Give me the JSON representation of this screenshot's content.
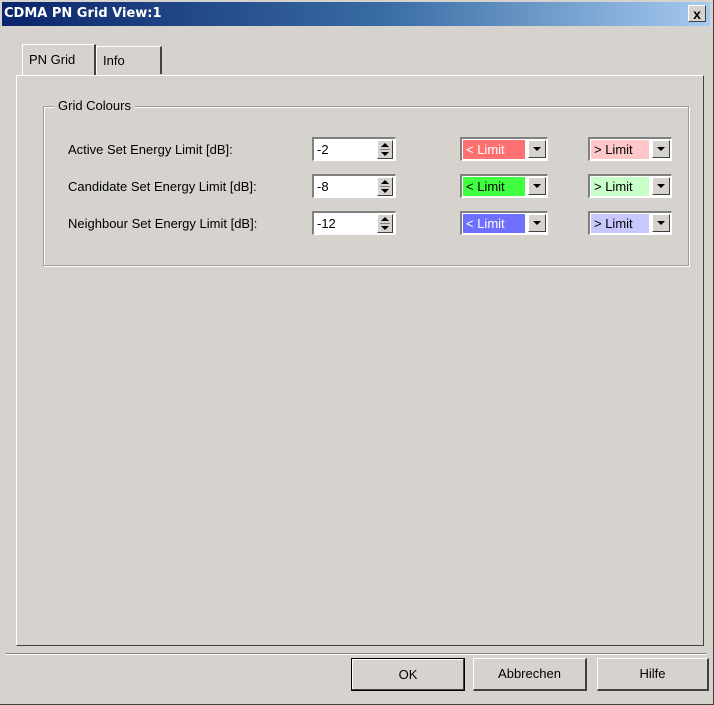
{
  "window": {
    "title": "CDMA PN Grid View:1",
    "close_label": "x"
  },
  "tabs": [
    {
      "label": "PN Grid",
      "active": true
    },
    {
      "label": "Info",
      "active": false
    }
  ],
  "group": {
    "title": "Grid Colours",
    "rows": [
      {
        "label": "Active Set Energy Limit [dB]:",
        "value": "-2",
        "lower": {
          "text": "< Limit",
          "color": "#ff7070",
          "text_color": "#ffffff"
        },
        "upper": {
          "text": "> Limit",
          "color": "#ffc8c8",
          "text_color": "#000000"
        }
      },
      {
        "label": "Candidate Set Energy Limit [dB]:",
        "value": "-8",
        "lower": {
          "text": "< Limit",
          "color": "#40ff40",
          "text_color": "#000000"
        },
        "upper": {
          "text": "> Limit",
          "color": "#c8ffc8",
          "text_color": "#000000"
        }
      },
      {
        "label": "Neighbour Set Energy Limit [dB]:",
        "value": "-12",
        "lower": {
          "text": "< Limit",
          "color": "#7070ff",
          "text_color": "#ffffff"
        },
        "upper": {
          "text": "> Limit",
          "color": "#c8c8ff",
          "text_color": "#000000"
        }
      }
    ]
  },
  "buttons": {
    "ok": "OK",
    "cancel": "Abbrechen",
    "help": "Hilfe"
  },
  "icons": {
    "spin": "spinner-arrows-icon",
    "dropdown": "chevron-down-icon"
  }
}
